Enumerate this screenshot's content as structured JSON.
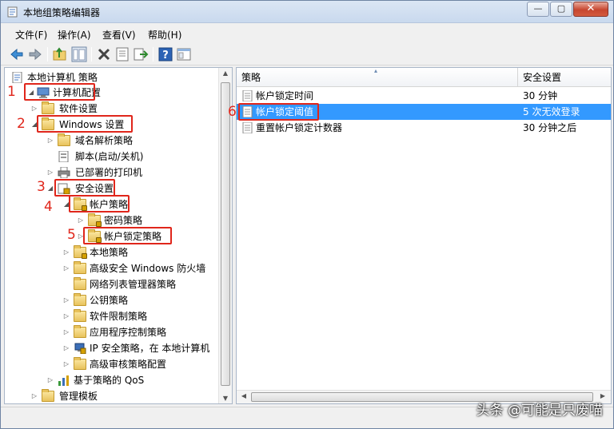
{
  "window": {
    "title": "本地组策略编辑器",
    "controls": {
      "minimize": "—",
      "maximize": "▢",
      "close": "✕"
    }
  },
  "menu": [
    "文件(F)",
    "操作(A)",
    "查看(V)",
    "帮助(H)"
  ],
  "toolbar_icons": [
    "back-icon",
    "forward-icon",
    "up-folder-icon",
    "show-hide-tree-icon",
    "delete-icon",
    "properties-icon",
    "export-icon",
    "help-icon",
    "view-icon"
  ],
  "tree": {
    "root": "本地计算机 策略",
    "items": [
      {
        "label": "计算机配置",
        "marker": "1"
      },
      {
        "label": "软件设置"
      },
      {
        "label": "Windows 设置",
        "marker": "2"
      },
      {
        "label": "域名解析策略"
      },
      {
        "label": "脚本(启动/关机)"
      },
      {
        "label": "已部署的打印机"
      },
      {
        "label": "安全设置",
        "marker": "3"
      },
      {
        "label": "帐户策略",
        "marker": "4"
      },
      {
        "label": "密码策略"
      },
      {
        "label": "帐户锁定策略",
        "marker": "5"
      },
      {
        "label": "本地策略"
      },
      {
        "label": "高级安全 Windows 防火墙"
      },
      {
        "label": "网络列表管理器策略"
      },
      {
        "label": "公钥策略"
      },
      {
        "label": "软件限制策略"
      },
      {
        "label": "应用程序控制策略"
      },
      {
        "label": "IP 安全策略，在 本地计算机"
      },
      {
        "label": "高级审核策略配置"
      },
      {
        "label": "基于策略的 QoS"
      },
      {
        "label": "管理模板"
      }
    ]
  },
  "list": {
    "columns": [
      "策略",
      "安全设置"
    ],
    "rows": [
      {
        "policy": "帐户锁定时间",
        "setting": "30 分钟"
      },
      {
        "policy": "帐户锁定阈值",
        "setting": "5 次无效登录",
        "selected": true,
        "marker": "6"
      },
      {
        "policy": "重置帐户锁定计数器",
        "setting": "30 分钟之后"
      }
    ]
  },
  "watermark": "头条 @可能是只废喵",
  "colors": {
    "selection": "#3399ff",
    "annotation": "#e0261b"
  }
}
